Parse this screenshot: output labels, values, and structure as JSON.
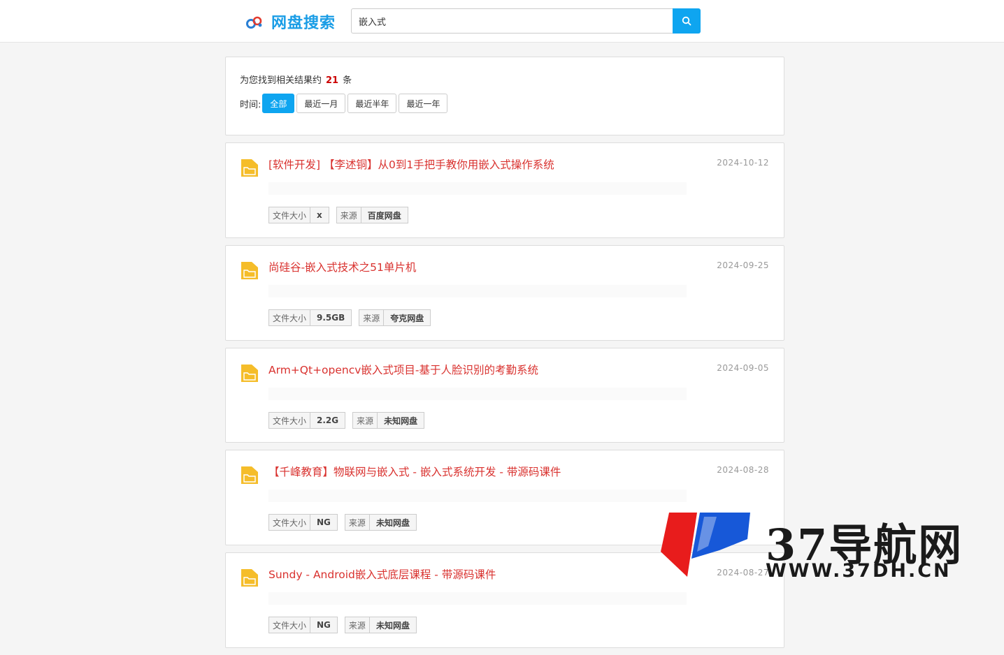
{
  "header": {
    "logo_text": "网盘搜索",
    "search_value": "嵌入式"
  },
  "summary": {
    "prefix": "为您找到相关结果约",
    "count": "21",
    "suffix": "条",
    "time_label": "时间:",
    "filters": [
      "全部",
      "最近一月",
      "最近半年",
      "最近一年"
    ],
    "active_filter": "全部"
  },
  "results": [
    {
      "title": "[软件开发] 【李述铜】从0到1手把手教你用嵌入式操作系统",
      "date": "2024-10-12",
      "size_label": "文件大小",
      "size": "x",
      "source_label": "来源",
      "source": "百度网盘"
    },
    {
      "title": "尚硅谷-嵌入式技术之51单片机",
      "date": "2024-09-25",
      "size_label": "文件大小",
      "size": "9.5GB",
      "source_label": "来源",
      "source": "夸克网盘"
    },
    {
      "title": "Arm+Qt+opencv嵌入式项目-基于人脸识别的考勤系统",
      "date": "2024-09-05",
      "size_label": "文件大小",
      "size": "2.2G",
      "source_label": "来源",
      "source": "未知网盘"
    },
    {
      "title": "【千峰教育】物联网与嵌入式 - 嵌入式系统开发 - 带源码课件",
      "date": "2024-08-28",
      "size_label": "文件大小",
      "size": "NG",
      "source_label": "来源",
      "source": "未知网盘"
    },
    {
      "title": "Sundy - Android嵌入式底层课程 - 带源码课件",
      "date": "2024-08-27",
      "size_label": "文件大小",
      "size": "NG",
      "source_label": "来源",
      "source": "未知网盘"
    }
  ],
  "watermark": {
    "title": "37导航网",
    "url": "WWW.37DH.CN"
  },
  "colors": {
    "brand": "#1a9de6",
    "accent": "#0ea5f0",
    "title_red": "#d9322f",
    "count_red": "#cc0000",
    "folder_yellow": "#f5bd2a"
  }
}
